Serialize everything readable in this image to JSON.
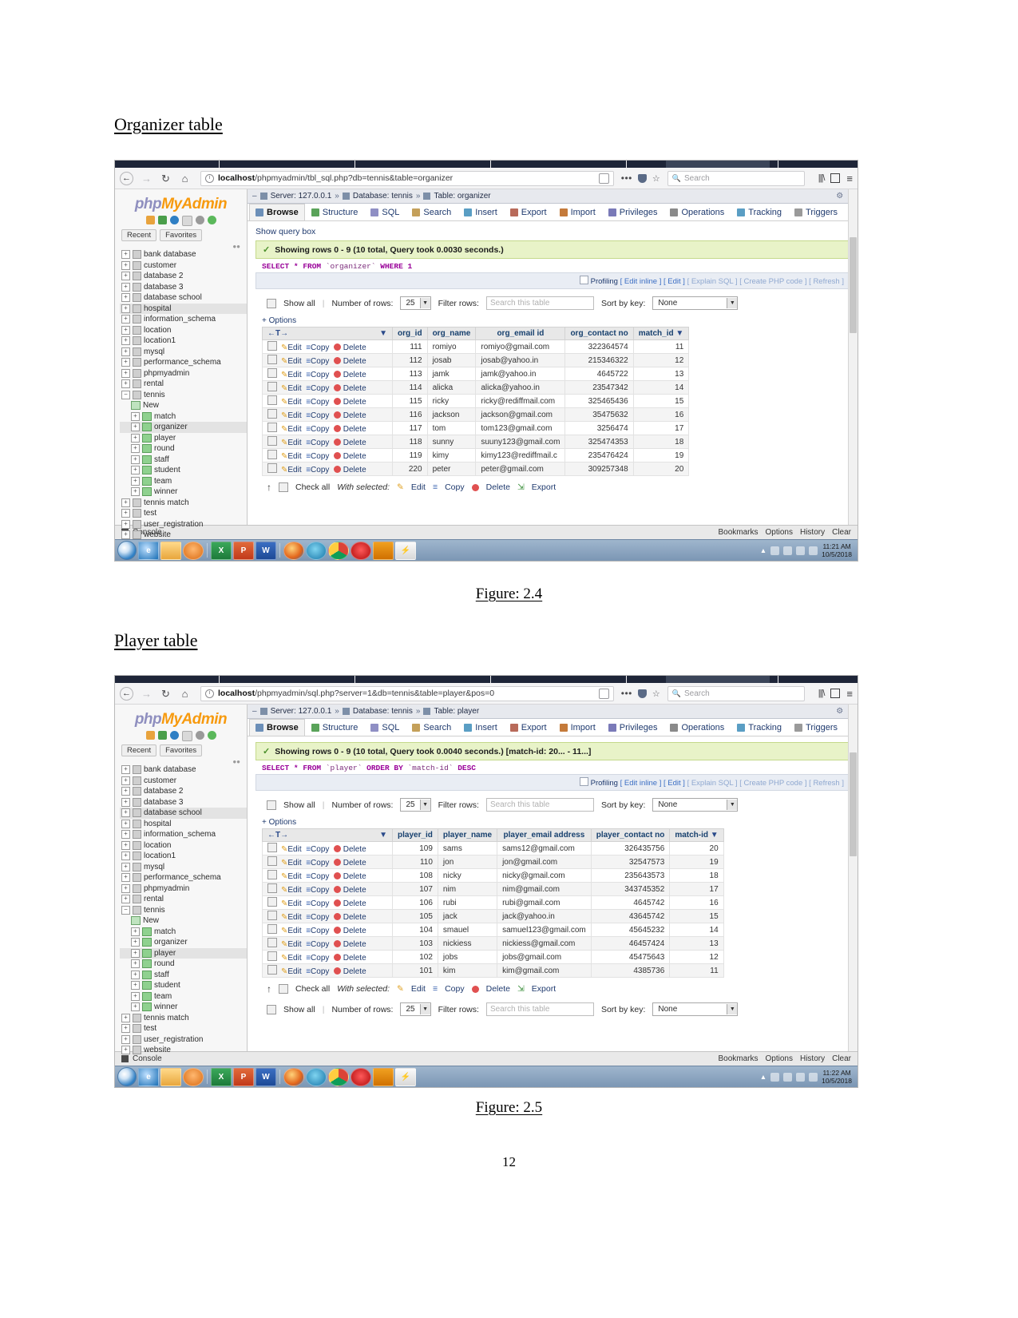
{
  "document": {
    "heading_organizer": "Organizer table",
    "heading_player": "Player table",
    "figure_24": "Figure: 2.4",
    "figure_25": "Figure: 2.5",
    "page_number": "12"
  },
  "browser": {
    "back_icon": "back-arrow-icon",
    "forward_icon": "forward-arrow-icon",
    "reload_icon": "reload-icon",
    "home_icon": "home-icon",
    "info_icon": "info-icon",
    "reader_icon": "reader-mode-icon",
    "menu_dots": "•••",
    "shield_icon": "shield-icon",
    "star_icon": "☆",
    "search_placeholder": "Search",
    "search_icon": "search-icon",
    "library_icon": "library-icon",
    "sidebar_icon": "sidebar-icon",
    "hamburger_icon": "≡"
  },
  "shot1": {
    "url_host": "localhost",
    "url_rest": "/phpmyadmin/tbl_sql.php?db=tennis&table=organizer"
  },
  "shot2": {
    "url_host": "localhost",
    "url_rest": "/phpmyadmin/sql.php?server=1&db=tennis&table=player&pos=0"
  },
  "pma": {
    "logo_part1": "php",
    "logo_part2": "MyAdmin",
    "recent": "Recent",
    "favorites": "Favorites",
    "tree": [
      {
        "label": "bank database",
        "type": "db",
        "selected": false
      },
      {
        "label": "customer",
        "type": "db",
        "selected": false
      },
      {
        "label": "database 2",
        "type": "db",
        "selected": false
      },
      {
        "label": "database 3",
        "type": "db",
        "selected": false
      },
      {
        "label": "database school",
        "type": "db",
        "selected": false
      },
      {
        "label": "hospital",
        "type": "db",
        "selected": true
      },
      {
        "label": "information_schema",
        "type": "db",
        "selected": false
      },
      {
        "label": "location",
        "type": "db",
        "selected": false
      },
      {
        "label": "location1",
        "type": "db",
        "selected": false
      },
      {
        "label": "mysql",
        "type": "db",
        "selected": false
      },
      {
        "label": "performance_schema",
        "type": "db",
        "selected": false
      },
      {
        "label": "phpmyadmin",
        "type": "db",
        "selected": false
      },
      {
        "label": "rental",
        "type": "db",
        "selected": false
      },
      {
        "label": "tennis",
        "type": "db-open",
        "selected": false
      },
      {
        "label": "New",
        "type": "new",
        "selected": false
      },
      {
        "label": "match",
        "type": "table",
        "selected": false
      },
      {
        "label": "organizer",
        "type": "table",
        "selected": true
      },
      {
        "label": "player",
        "type": "table",
        "selected": false
      },
      {
        "label": "round",
        "type": "table",
        "selected": false
      },
      {
        "label": "staff",
        "type": "table",
        "selected": false
      },
      {
        "label": "student",
        "type": "table",
        "selected": false
      },
      {
        "label": "team",
        "type": "table",
        "selected": false
      },
      {
        "label": "winner",
        "type": "table",
        "selected": false
      },
      {
        "label": "tennis match",
        "type": "db",
        "selected": false
      },
      {
        "label": "test",
        "type": "db",
        "selected": false
      },
      {
        "label": "user_registration",
        "type": "db",
        "selected": false
      },
      {
        "label": "website",
        "type": "db",
        "selected": false
      }
    ],
    "tree2": [
      {
        "label": "bank database",
        "type": "db",
        "selected": false
      },
      {
        "label": "customer",
        "type": "db",
        "selected": false
      },
      {
        "label": "database 2",
        "type": "db",
        "selected": false
      },
      {
        "label": "database 3",
        "type": "db",
        "selected": false
      },
      {
        "label": "database school",
        "type": "db",
        "selected": true
      },
      {
        "label": "hospital",
        "type": "db",
        "selected": false
      },
      {
        "label": "information_schema",
        "type": "db",
        "selected": false
      },
      {
        "label": "location",
        "type": "db",
        "selected": false
      },
      {
        "label": "location1",
        "type": "db",
        "selected": false
      },
      {
        "label": "mysql",
        "type": "db",
        "selected": false
      },
      {
        "label": "performance_schema",
        "type": "db",
        "selected": false
      },
      {
        "label": "phpmyadmin",
        "type": "db",
        "selected": false
      },
      {
        "label": "rental",
        "type": "db",
        "selected": false
      },
      {
        "label": "tennis",
        "type": "db-open",
        "selected": false
      },
      {
        "label": "New",
        "type": "new",
        "selected": false
      },
      {
        "label": "match",
        "type": "table",
        "selected": false
      },
      {
        "label": "organizer",
        "type": "table",
        "selected": false
      },
      {
        "label": "player",
        "type": "table",
        "selected": true
      },
      {
        "label": "round",
        "type": "table",
        "selected": false
      },
      {
        "label": "staff",
        "type": "table",
        "selected": false
      },
      {
        "label": "student",
        "type": "table",
        "selected": false
      },
      {
        "label": "team",
        "type": "table",
        "selected": false
      },
      {
        "label": "winner",
        "type": "table",
        "selected": false
      },
      {
        "label": "tennis match",
        "type": "db",
        "selected": false
      },
      {
        "label": "test",
        "type": "db",
        "selected": false
      },
      {
        "label": "user_registration",
        "type": "db",
        "selected": false
      },
      {
        "label": "website",
        "type": "db",
        "selected": false
      }
    ],
    "tabs": [
      {
        "label": "Browse",
        "icon": "browse-icon",
        "active": true
      },
      {
        "label": "Structure",
        "icon": "structure-icon",
        "active": false
      },
      {
        "label": "SQL",
        "icon": "sql-icon",
        "active": false
      },
      {
        "label": "Search",
        "icon": "search-icon",
        "active": false
      },
      {
        "label": "Insert",
        "icon": "insert-icon",
        "active": false
      },
      {
        "label": "Export",
        "icon": "export-icon",
        "active": false
      },
      {
        "label": "Import",
        "icon": "import-icon",
        "active": false
      },
      {
        "label": "Privileges",
        "icon": "privileges-icon",
        "active": false
      },
      {
        "label": "Operations",
        "icon": "operations-icon",
        "active": false
      },
      {
        "label": "Tracking",
        "icon": "tracking-icon",
        "active": false
      },
      {
        "label": "Triggers",
        "icon": "triggers-icon",
        "active": false
      }
    ],
    "controls": {
      "show_all": "Show all",
      "number_of_rows_label": "Number of rows:",
      "number_of_rows_value": "25",
      "filter_rows_label": "Filter rows:",
      "filter_placeholder": "Search this table",
      "sort_by_key_label": "Sort by key:",
      "sort_by_key_value": "None",
      "options": "+ Options"
    },
    "profiling": {
      "label": "Profiling",
      "edit_inline": "[ Edit inline ]",
      "edit": "[ Edit ]",
      "explain_sql": "[ Explain SQL ]",
      "create_php": "[ Create PHP code ]",
      "refresh": "[ Refresh ]"
    },
    "footer": {
      "check_all": "Check all",
      "with_selected": "With selected:",
      "edit": "Edit",
      "copy": "Copy",
      "delete": "Delete",
      "export": "Export"
    },
    "console": {
      "label": "Console",
      "bookmarks": "Bookmarks",
      "options": "Options",
      "history": "History",
      "clear": "Clear"
    },
    "row_actions": {
      "edit": "Edit",
      "copy": "Copy",
      "delete": "Delete"
    }
  },
  "organizer_view": {
    "show_query_box": "Show query box",
    "breadcrumb": {
      "server": "Server: 127.0.0.1",
      "database": "Database: tennis",
      "table": "Table: organizer"
    },
    "status": "Showing rows 0 - 9 (10 total, Query took 0.0030 seconds.)",
    "sql_keyword1": "SELECT",
    "sql_star": "*",
    "sql_keyword2": "FROM",
    "sql_table": "`organizer`",
    "sql_keyword3": "WHERE",
    "sql_cond": "1",
    "columns": [
      "org_id",
      "org_name",
      "org_email id",
      "org_contact no",
      "match_id"
    ],
    "rows": [
      {
        "org_id": "111",
        "org_name": "romiyo",
        "email": "romiyo@gmail.com",
        "contact": "322364574",
        "match_id": "11"
      },
      {
        "org_id": "112",
        "org_name": "josab",
        "email": "josab@yahoo.in",
        "contact": "215346322",
        "match_id": "12"
      },
      {
        "org_id": "113",
        "org_name": "jamk",
        "email": "jamk@yahoo.in",
        "contact": "4645722",
        "match_id": "13"
      },
      {
        "org_id": "114",
        "org_name": "alicka",
        "email": "alicka@yahoo.in",
        "contact": "23547342",
        "match_id": "14"
      },
      {
        "org_id": "115",
        "org_name": "ricky",
        "email": "ricky@rediffmail.com",
        "contact": "325465436",
        "match_id": "15"
      },
      {
        "org_id": "116",
        "org_name": "jackson",
        "email": "jackson@gmail.com",
        "contact": "35475632",
        "match_id": "16"
      },
      {
        "org_id": "117",
        "org_name": "tom",
        "email": "tom123@gmail.com",
        "contact": "3256474",
        "match_id": "17"
      },
      {
        "org_id": "118",
        "org_name": "sunny",
        "email": "suuny123@gmail.com",
        "contact": "325474353",
        "match_id": "18"
      },
      {
        "org_id": "119",
        "org_name": "kimy",
        "email": "kimy123@rediffmail.c",
        "contact": "235476424",
        "match_id": "19"
      },
      {
        "org_id": "220",
        "org_name": "peter",
        "email": "peter@gmail.com",
        "contact": "309257348",
        "match_id": "20"
      }
    ]
  },
  "player_view": {
    "breadcrumb": {
      "server": "Server: 127.0.0.1",
      "database": "Database: tennis",
      "table": "Table: player"
    },
    "status": "Showing rows 0 - 9 (10 total, Query took 0.0040 seconds.) [match-id: 20... - 11...]",
    "sql_keyword1": "SELECT",
    "sql_star": "*",
    "sql_keyword2": "FROM",
    "sql_table": "`player`",
    "sql_keyword3": "ORDER BY",
    "sql_col": "`match-id`",
    "sql_keyword4": "DESC",
    "columns": [
      "player_id",
      "player_name",
      "player_email address",
      "player_contact no",
      "match-id"
    ],
    "rows": [
      {
        "player_id": "109",
        "player_name": "sams",
        "email": "sams12@gmail.com",
        "contact": "326435756",
        "match_id": "20"
      },
      {
        "player_id": "110",
        "player_name": "jon",
        "email": "jon@gmail.com",
        "contact": "32547573",
        "match_id": "19"
      },
      {
        "player_id": "108",
        "player_name": "nicky",
        "email": "nicky@gmail.com",
        "contact": "235643573",
        "match_id": "18"
      },
      {
        "player_id": "107",
        "player_name": "nim",
        "email": "nim@gmail.com",
        "contact": "343745352",
        "match_id": "17"
      },
      {
        "player_id": "106",
        "player_name": "rubi",
        "email": "rubi@gmail.com",
        "contact": "4645742",
        "match_id": "16"
      },
      {
        "player_id": "105",
        "player_name": "jack",
        "email": "jack@yahoo.in",
        "contact": "43645742",
        "match_id": "15"
      },
      {
        "player_id": "104",
        "player_name": "smauel",
        "email": "samuel123@gmail.com",
        "contact": "45645232",
        "match_id": "14"
      },
      {
        "player_id": "103",
        "player_name": "nickiess",
        "email": "nickiess@gmail.com",
        "contact": "46457424",
        "match_id": "13"
      },
      {
        "player_id": "102",
        "player_name": "jobs",
        "email": "jobs@gmail.com",
        "contact": "45475643",
        "match_id": "12"
      },
      {
        "player_id": "101",
        "player_name": "kim",
        "email": "kim@gmail.com",
        "contact": "4385736",
        "match_id": "11"
      }
    ]
  },
  "taskbar": {
    "start_icon": "windows-start-icon",
    "items": [
      "ie-icon",
      "folder-icon",
      "vlc-icon",
      "excel-icon",
      "powerpoint-icon",
      "word-icon",
      "firefox-icon",
      "edge-icon",
      "chrome-icon",
      "opera-icon",
      "obs-icon",
      "flash-icon"
    ],
    "time1": "11:21 AM",
    "date1": "10/5/2018",
    "time2": "11:22 AM",
    "date2": "10/5/2018"
  }
}
